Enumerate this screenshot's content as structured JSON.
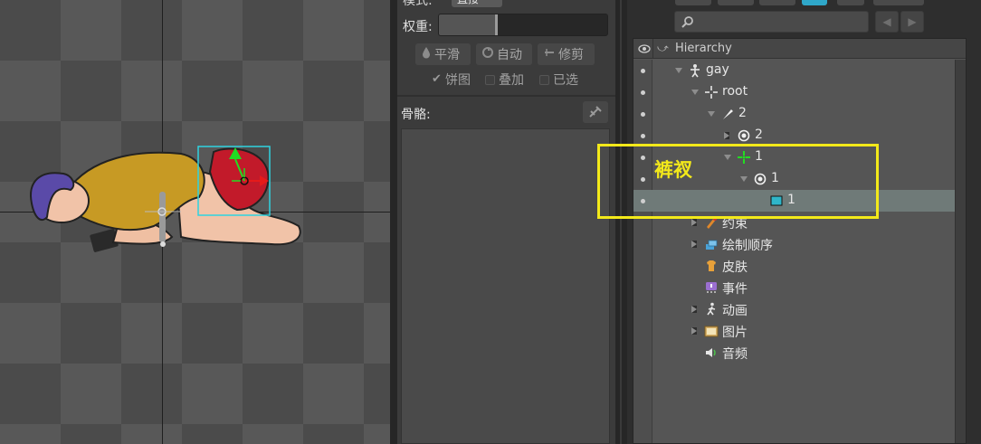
{
  "middle_panel": {
    "mode_label": "模式:",
    "mode_value": "直接",
    "weight_label": "权重:",
    "weight_value": 0.34,
    "tools": [
      {
        "id": "smooth",
        "label": "平滑",
        "icon": "droplet-icon"
      },
      {
        "id": "auto",
        "label": "自动",
        "icon": "auto-icon"
      },
      {
        "id": "prune",
        "label": "修剪",
        "icon": "prune-icon"
      }
    ],
    "checkboxes": [
      {
        "id": "pie",
        "label": "饼图",
        "checked": true
      },
      {
        "id": "overlay",
        "label": "叠加",
        "checked": false
      },
      {
        "id": "selected",
        "label": "已选",
        "checked": false
      }
    ],
    "bones_label": "骨骼:"
  },
  "hierarchy": {
    "title": "Hierarchy",
    "search_placeholder": "",
    "nodes": [
      {
        "label": "gay",
        "icon": "skeleton-icon",
        "depth": 0,
        "expanded": true
      },
      {
        "label": "root",
        "icon": "bone-root-icon",
        "depth": 1,
        "expanded": true
      },
      {
        "label": "2",
        "icon": "bone-icon",
        "depth": 2,
        "expanded": true
      },
      {
        "label": "2",
        "icon": "slot-icon",
        "depth": 3,
        "expanded": false
      },
      {
        "label": "1",
        "icon": "bone-green-icon",
        "depth": 3,
        "expanded": true
      },
      {
        "label": "1",
        "icon": "slot-icon",
        "depth": 4,
        "expanded": true
      },
      {
        "label": "1",
        "icon": "mesh-icon",
        "depth": 5,
        "expanded": null,
        "selected": true
      },
      {
        "label": "约束",
        "icon": "constraint-icon",
        "depth": 1,
        "expanded": false
      },
      {
        "label": "绘制顺序",
        "icon": "draw-order-icon",
        "depth": 1,
        "expanded": false
      },
      {
        "label": "皮肤",
        "icon": "skin-icon",
        "depth": 1,
        "expanded": null
      },
      {
        "label": "事件",
        "icon": "event-icon",
        "depth": 1,
        "expanded": null
      },
      {
        "label": "动画",
        "icon": "animation-icon",
        "depth": 1,
        "expanded": false
      },
      {
        "label": "图片",
        "icon": "images-icon",
        "depth": 1,
        "expanded": false
      },
      {
        "label": "音频",
        "icon": "audio-icon",
        "depth": 1,
        "expanded": null
      }
    ]
  },
  "annotation": {
    "label": "裤衩",
    "color": "#f3e91a"
  },
  "colors": {
    "selection": "#6f7a78",
    "accent_cyan": "#2fd3e0",
    "accent_green": "#22dd22",
    "accent_red": "#e61a1a"
  }
}
